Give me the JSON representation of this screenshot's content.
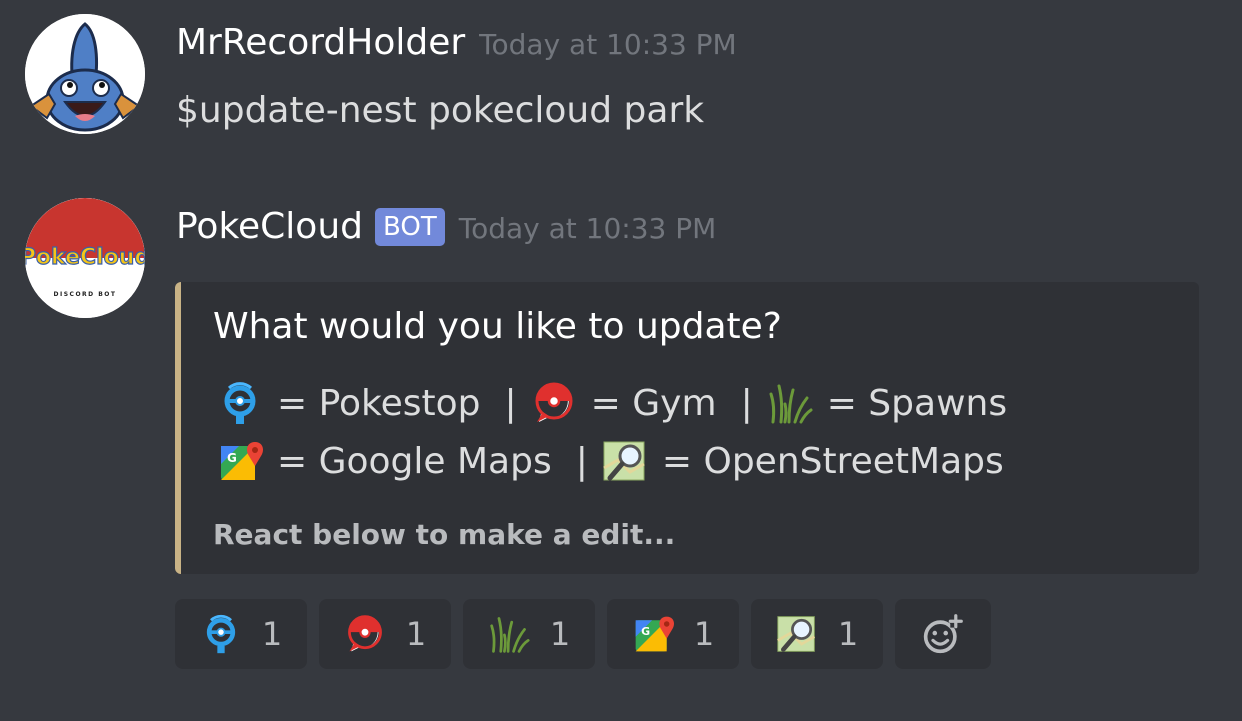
{
  "messages": [
    {
      "username": "MrRecordHolder",
      "timestamp": "Today at 10:33 PM",
      "content": "$update-nest pokecloud park",
      "avatar_icon": "mudkip-avatar"
    },
    {
      "username": "PokeCloud",
      "bot_tag": "BOT",
      "timestamp": "Today at 10:33 PM",
      "avatar_icon": "pokecloud-logo-avatar",
      "avatar_logo_text": "PokeCloud",
      "avatar_logo_subtext": "DISCORD BOT",
      "embed": {
        "accent_color": "#c9b386",
        "title": "What would you like to update?",
        "line1": [
          {
            "icon": "pokestop-icon",
            "label": "= Pokestop"
          },
          {
            "sep": "|"
          },
          {
            "icon": "gym-icon",
            "label": "= Gym"
          },
          {
            "sep": "|"
          },
          {
            "icon": "grass-icon",
            "label": "= Spawns"
          }
        ],
        "line1_labels": {
          "pokestop": "= Pokestop",
          "gym": "= Gym",
          "spawns": "= Spawns",
          "sep": "|"
        },
        "line2_labels": {
          "google_maps": "= Google Maps",
          "osm": "= OpenStreetMaps",
          "sep": "|"
        },
        "footer": "React below to make a edit..."
      },
      "reactions": [
        {
          "icon": "pokestop-icon",
          "count": "1"
        },
        {
          "icon": "gym-icon",
          "count": "1"
        },
        {
          "icon": "grass-icon",
          "count": "1"
        },
        {
          "icon": "google-maps-icon",
          "count": "1"
        },
        {
          "icon": "openstreetmap-icon",
          "count": "1"
        },
        {
          "icon": "add-reaction-icon",
          "count": ""
        }
      ]
    }
  ],
  "colors": {
    "background": "#36393f",
    "embed_background": "#2f3136",
    "bot_tag": "#7289da",
    "timestamp": "#72767d"
  }
}
